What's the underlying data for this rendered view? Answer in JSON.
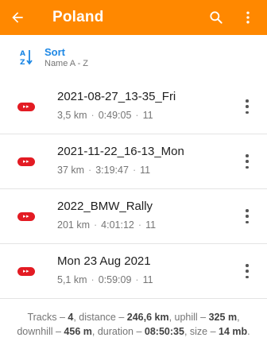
{
  "appbar": {
    "title": "Poland"
  },
  "sort": {
    "label": "Sort",
    "sub": "Name A - Z",
    "icon_top": "A",
    "icon_bottom": "Z"
  },
  "tracks": [
    {
      "name": "2021-08-27_13-35_Fri",
      "distance": "3,5 km",
      "duration": "0:49:05",
      "points": "11"
    },
    {
      "name": "2021-11-22_16-13_Mon",
      "distance": "37 km",
      "duration": "3:19:47",
      "points": "11"
    },
    {
      "name": "2022_BMW_Rally",
      "distance": "201 km",
      "duration": "4:01:12",
      "points": "11"
    },
    {
      "name": "Mon 23 Aug 2021",
      "distance": "5,1 km",
      "duration": "0:59:09",
      "points": "11"
    }
  ],
  "summary": {
    "tracks_label": "Tracks – ",
    "tracks": "4",
    "distance_label": ", distance – ",
    "distance": "246,6 km",
    "uphill_label": ", uphill – ",
    "uphill": "325 m",
    "downhill_label": ", downhill – ",
    "downhill": "456 m",
    "duration_label": ", duration – ",
    "duration": "08:50:35",
    "size_label": ", size – ",
    "size": "14 mb",
    "end": "."
  },
  "colors": {
    "accent": "#ff8800",
    "link": "#1e88e5",
    "track_icon": "#e31b23"
  },
  "icons": {
    "back": "arrow-back-icon",
    "search": "search-icon",
    "more": "more-vert-icon",
    "sort": "sort-az-icon",
    "track": "track-icon"
  }
}
